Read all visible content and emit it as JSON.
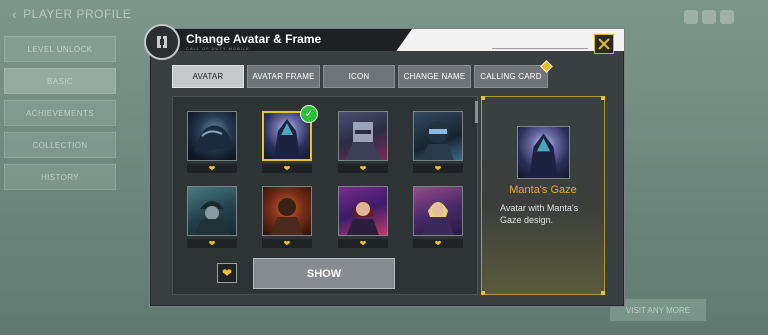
{
  "background": {
    "title": "PLAYER PROFILE",
    "sidebar": [
      "LEVEL UNLOCK",
      "BASIC",
      "ACHIEVEMENTS",
      "COLLECTION",
      "HISTORY"
    ],
    "right_button": "VISIT ANY MORE"
  },
  "dialog": {
    "title": "Change Avatar & Frame",
    "subtitle": "CALL OF DUTY MOBILE",
    "tabs": [
      {
        "label": "AVATAR",
        "active": true
      },
      {
        "label": "AVATAR FRAME",
        "active": false
      },
      {
        "label": "ICON",
        "active": false
      },
      {
        "label": "CHANGE NAME",
        "active": false
      },
      {
        "label": "CALLING CARD",
        "active": false,
        "badge": true
      }
    ],
    "avatars": [
      {
        "name": "dark-creature-avatar",
        "selected": false
      },
      {
        "name": "mantas-gaze-avatar",
        "selected": true
      },
      {
        "name": "armored-soldier-avatar",
        "selected": false
      },
      {
        "name": "masked-operator-avatar",
        "selected": false
      },
      {
        "name": "hooded-operator-avatar",
        "selected": false
      },
      {
        "name": "burning-soldier-avatar",
        "selected": false
      },
      {
        "name": "red-hair-operator-avatar",
        "selected": false
      },
      {
        "name": "blonde-operator-avatar",
        "selected": false
      }
    ],
    "show_button": "SHOW",
    "detail": {
      "name": "Manta's Gaze",
      "description": "Avatar with Manta's Gaze design."
    },
    "colors": {
      "accent": "#e6c230",
      "detail_name": "#efa82a",
      "check": "#2fbe3b"
    }
  }
}
